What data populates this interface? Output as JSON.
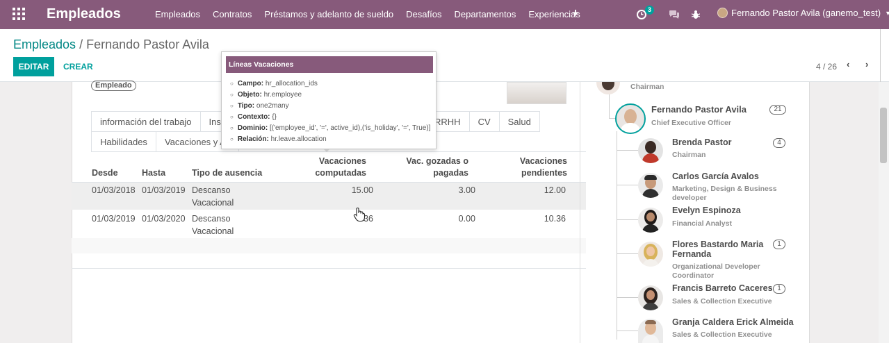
{
  "navbar": {
    "app_title": "Empleados",
    "menu": [
      "Empleados",
      "Contratos",
      "Préstamos y adelanto de sueldo",
      "Desafíos",
      "Departamentos",
      "Experiencias"
    ],
    "plus": "+",
    "activity_badge": "3",
    "user_name": "Fernando Pastor Avila (ganemo_test)"
  },
  "breadcrumb": {
    "parent": "Empleados",
    "separator": "/",
    "current": "Fernando Pastor Avila"
  },
  "buttons": {
    "edit": "EDITAR",
    "create": "CREAR"
  },
  "pager": {
    "value": "4 / 26",
    "prev": "‹",
    "next": "›"
  },
  "employee": {
    "tag": "Empleado"
  },
  "tabs_row1": [
    "información del trabajo",
    "Insig",
    "RRHH",
    "CV",
    "Salud"
  ],
  "tabs_row2": [
    "Habilidades",
    "Vacaciones y As"
  ],
  "table": {
    "headers": {
      "desde": "Desde",
      "hasta": "Hasta",
      "tipo": "Tipo de ausencia",
      "computadas_1": "Vacaciones",
      "computadas_2": "computadas",
      "gozadas_1": "Vac. gozadas o",
      "gozadas_2": "pagadas",
      "pendientes_1": "Vacaciones",
      "pendientes_2": "pendientes"
    },
    "rows": [
      {
        "desde": "01/03/2018",
        "hasta": "01/03/2019",
        "tipo_1": "Descanso",
        "tipo_2": "Vacacional",
        "computadas": "15.00",
        "gozadas": "3.00",
        "pendientes": "12.00"
      },
      {
        "desde": "01/03/2019",
        "hasta": "01/03/2020",
        "tipo_1": "Descanso",
        "tipo_2": "Vacacional",
        "computadas": "36",
        "gozadas": "0.00",
        "pendientes": "10.36"
      }
    ]
  },
  "tooltip": {
    "title": "Líneas Vacaciones",
    "items": [
      {
        "label": "Campo:",
        "value": "hr_allocation_ids"
      },
      {
        "label": "Objeto:",
        "value": "hr.employee"
      },
      {
        "label": "Tipo:",
        "value": "one2many"
      },
      {
        "label": "Contexto:",
        "value": "{}"
      },
      {
        "label": "Dominio:",
        "value": "[('employee_id', '=', active_id),('is_holiday', '=', True)]"
      },
      {
        "label": "Relación:",
        "value": "hr.leave.allocation"
      }
    ]
  },
  "org_chart": {
    "manager_job": "Chairman",
    "self": {
      "name": "Fernando Pastor Avila",
      "job": "Chief Executive Officer",
      "count": "21"
    },
    "subordinates": [
      {
        "name_1": "Brenda Pastor",
        "name_2": "",
        "job_1": "Chairman",
        "job_2": "",
        "count": "4"
      },
      {
        "name_1": "Carlos García Avalos",
        "name_2": "",
        "job_1": "Marketing, Design & Business",
        "job_2": "developer",
        "count": ""
      },
      {
        "name_1": "Evelyn Espinoza",
        "name_2": "",
        "job_1": "Financial Analyst",
        "job_2": "",
        "count": ""
      },
      {
        "name_1": "Flores Bastardo Maria",
        "name_2": "Fernanda",
        "job_1": "Organizational Developer",
        "job_2": "Coordinator",
        "count": "1"
      },
      {
        "name_1": "Francis Barreto Caceres",
        "name_2": "",
        "job_1": "Sales & Collection Executive",
        "job_2": "",
        "count": "1"
      },
      {
        "name_1": "Granja Caldera Erick Almeida",
        "name_2": "",
        "job_1": "Sales & Collection Executive",
        "job_2": "",
        "count": ""
      }
    ]
  },
  "colors": {
    "brand": "#875a7b",
    "accent": "#00a09d"
  }
}
